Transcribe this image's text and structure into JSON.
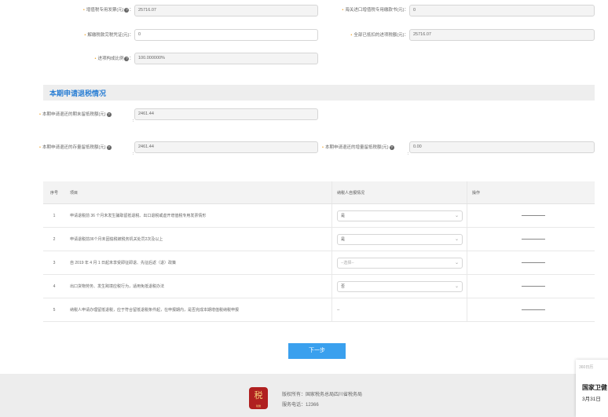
{
  "top_fields": {
    "vat_invoice_label": "增值税专用发票(元)",
    "vat_invoice_value": "25716.07",
    "customs_label": "海关进口增值税专用缴款书(元)：",
    "customs_value": "0",
    "paid_tax_label": "解缴税款完税凭证(元)：",
    "paid_tax_value": "0",
    "all_deducted_label": "全部已抵扣的进项税额(元)：",
    "all_deducted_value": "25716.07",
    "ratio_label": "进项构成比例",
    "ratio_value": "100.000000%"
  },
  "section": {
    "title": "本期申请退税情况",
    "period_end_label": "本期申请退还的期末留抵税额(元)",
    "period_end_value": "2461.44",
    "stock_label": "本期申请退还的存量留抵税额(元)",
    "stock_value": "2461.44",
    "increment_label": "本期申请退还的增量留抵税额(元)",
    "increment_value": "0.00",
    "colon": ":"
  },
  "table": {
    "headers": {
      "no": "序号",
      "item": "项目",
      "self_check": "纳税人自报情况",
      "op": "操作"
    },
    "rows": [
      {
        "no": "1",
        "item": "申请退税前 36 个月未发生骗取留抵退税、出口退税或虚开增值税专用发票情形",
        "value": "是",
        "placeholder": false
      },
      {
        "no": "2",
        "item": "申请退税前36个月未因偷税被税务机关处罚2次及以上",
        "value": "是",
        "placeholder": false
      },
      {
        "no": "3",
        "item": "自 2019 年 4 月 1 日起未享受即征即退、先征后返（退）政策",
        "value": "--选择--",
        "placeholder": true
      },
      {
        "no": "4",
        "item": "出口货物劳务、发生跨境应税行为，适用免抵退税办法",
        "value": "否",
        "placeholder": false
      },
      {
        "no": "5",
        "item": "纳税人申请办理留抵退税，应于符合留抵退税条件起，在申报期内，是否完成本期增值税纳税申报",
        "value": "--",
        "placeholder": false
      }
    ]
  },
  "buttons": {
    "next": "下一步"
  },
  "footer": {
    "copyright": "版权所有：国家税务总局四川省税务局",
    "phone": "服务电话：12366",
    "logo_text": "税",
    "logo_caption": "税徽"
  },
  "popup": {
    "source": "360日历",
    "title": "国家卫健",
    "date": "3月31日"
  },
  "colors": {
    "accent": "#3aa0ee",
    "title_blue": "#2b7fd4",
    "required_star": "#f0a020"
  }
}
